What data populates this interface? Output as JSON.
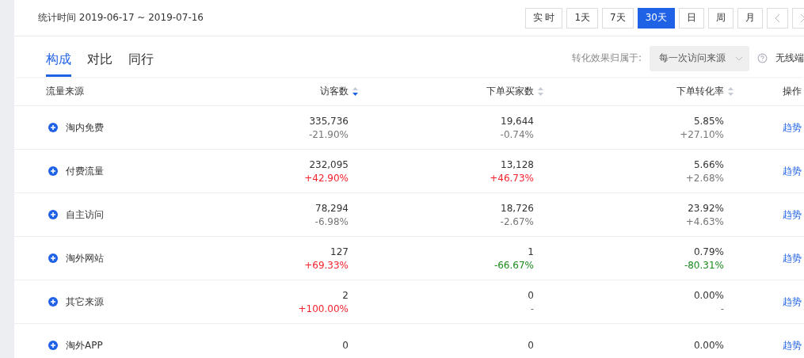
{
  "stat_time": "统计时间 2019-06-17 ~ 2019-07-16",
  "range_buttons": [
    {
      "label": "实 时",
      "selected": false
    },
    {
      "label": "1天",
      "selected": false
    },
    {
      "label": "7天",
      "selected": false
    },
    {
      "label": "30天",
      "selected": true
    },
    {
      "label": "日",
      "selected": false
    },
    {
      "label": "周",
      "selected": false
    },
    {
      "label": "月",
      "selected": false
    }
  ],
  "tabs": [
    {
      "label": "构成",
      "selected": true
    },
    {
      "label": "对比",
      "selected": false
    },
    {
      "label": "同行",
      "selected": false
    }
  ],
  "attribution": {
    "label": "转化效果归属于:",
    "value": "每一次访问来源"
  },
  "device_label": "无线端",
  "table": {
    "columns": [
      {
        "label": "流量来源",
        "kind": "plain"
      },
      {
        "label": "访客数",
        "kind": "sortable",
        "sorted": true
      },
      {
        "label": "下单买家数",
        "kind": "sortable",
        "sorted": false
      },
      {
        "label": "下单转化率",
        "kind": "sortable",
        "sorted": false
      },
      {
        "label": "操作",
        "kind": "plain"
      }
    ],
    "rows": [
      {
        "source": "淘内免费",
        "visitors": {
          "value": "335,736",
          "change": "-21.90%",
          "color": "#777777"
        },
        "buyers": {
          "value": "19,644",
          "change": "-0.74%",
          "color": "#777777"
        },
        "rate": {
          "value": "5.85%",
          "change": "+27.10%",
          "color": "#777777"
        },
        "action": "趋势"
      },
      {
        "source": "付费流量",
        "visitors": {
          "value": "232,095",
          "change": "+42.90%",
          "color": "#f5222d"
        },
        "buyers": {
          "value": "13,128",
          "change": "+46.73%",
          "color": "#f5222d"
        },
        "rate": {
          "value": "5.66%",
          "change": "+2.68%",
          "color": "#777777"
        },
        "action": "趋势"
      },
      {
        "source": "自主访问",
        "visitors": {
          "value": "78,294",
          "change": "-6.98%",
          "color": "#777777"
        },
        "buyers": {
          "value": "18,726",
          "change": "-2.67%",
          "color": "#777777"
        },
        "rate": {
          "value": "23.92%",
          "change": "+4.63%",
          "color": "#777777"
        },
        "action": "趋势"
      },
      {
        "source": "淘外网站",
        "visitors": {
          "value": "127",
          "change": "+69.33%",
          "color": "#f5222d"
        },
        "buyers": {
          "value": "1",
          "change": "-66.67%",
          "color": "#1a8a1a"
        },
        "rate": {
          "value": "0.79%",
          "change": "-80.31%",
          "color": "#1a8a1a"
        },
        "action": "趋势"
      },
      {
        "source": "其它来源",
        "visitors": {
          "value": "2",
          "change": "+100.00%",
          "color": "#f5222d"
        },
        "buyers": {
          "value": "0",
          "change": "-"
        },
        "rate": {
          "value": "0.00%",
          "change": "-"
        },
        "action": "趋势"
      },
      {
        "source": "淘外APP",
        "visitors": {
          "value": "0"
        },
        "buyers": {
          "value": "0"
        },
        "rate": {
          "value": "0.00%"
        },
        "action": "趋势"
      }
    ]
  }
}
